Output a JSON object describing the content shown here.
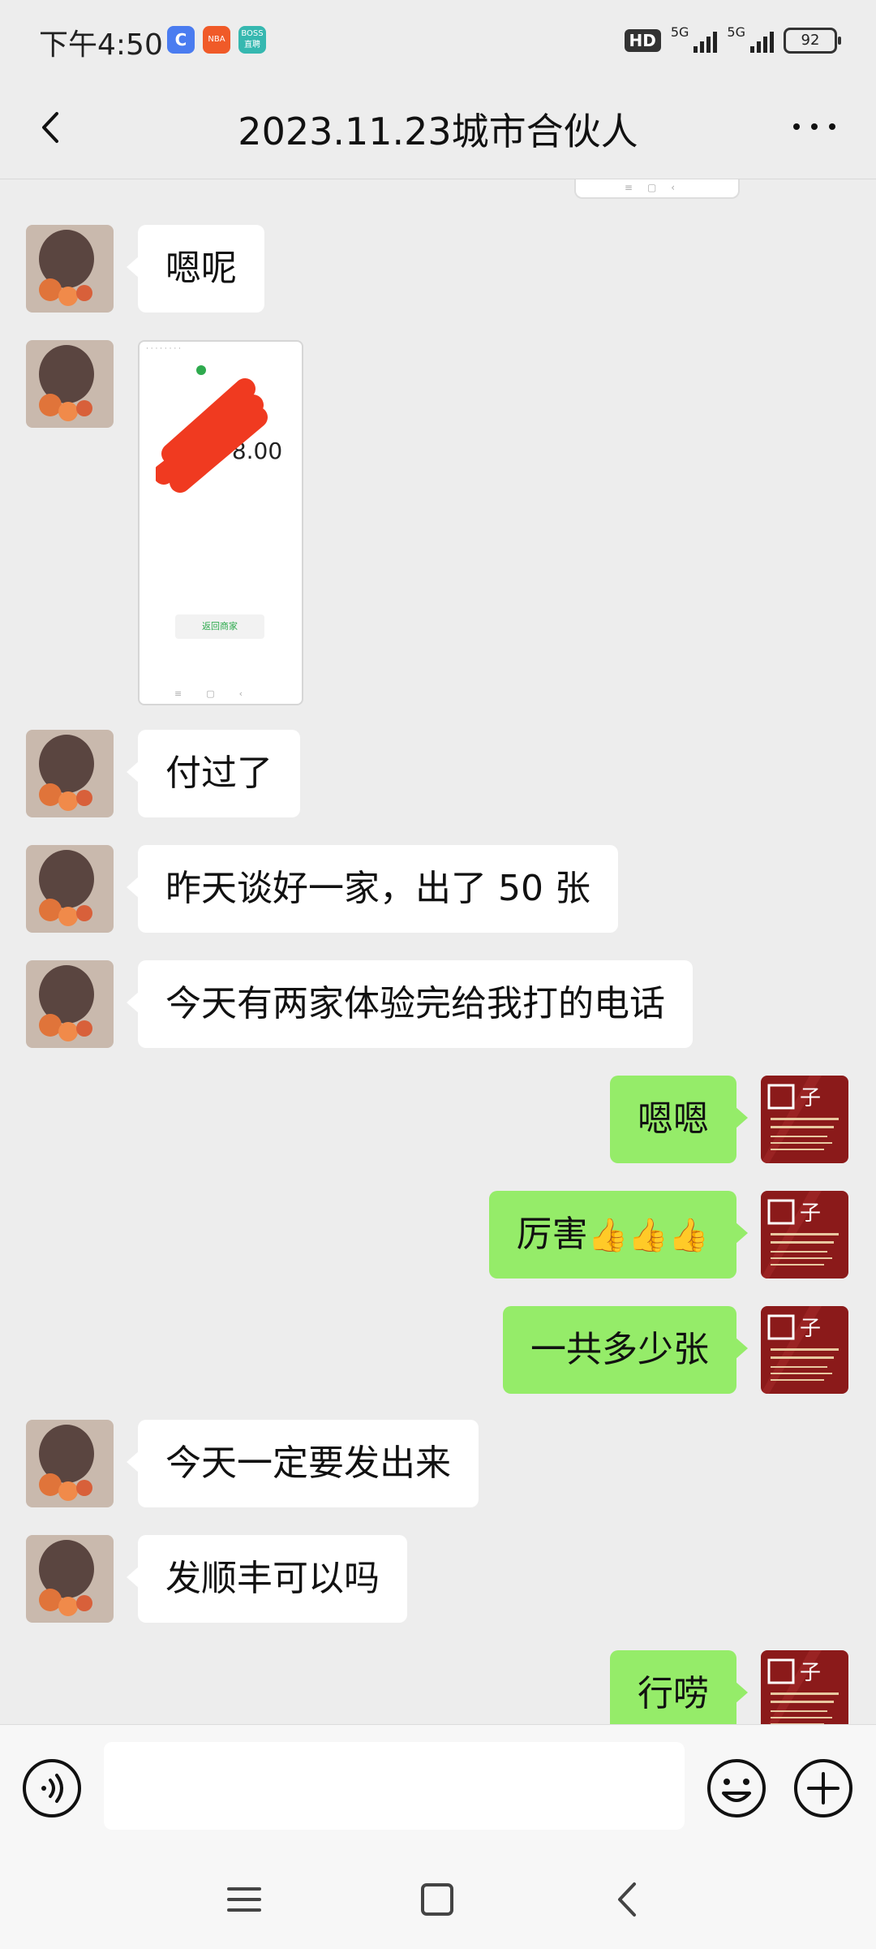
{
  "status_bar": {
    "time": "下午4:50",
    "apps": [
      {
        "name": "c-app-icon",
        "label": "C",
        "color": "#4a7cf0"
      },
      {
        "name": "nba-app-icon",
        "label": "NBA",
        "color": "#f05a28"
      },
      {
        "name": "boss-app-icon",
        "label": "BOSS直聘",
        "color": "#36b8b0"
      }
    ],
    "hd_label": "HD",
    "network_1": "5G",
    "network_2": "5G",
    "battery": "92"
  },
  "header": {
    "title": "2023.11.23城市合伙人",
    "back_icon": "chevron-left-icon",
    "more_icon": "more-dots-icon"
  },
  "messages": [
    {
      "side": "left",
      "type": "text",
      "text": "嗯呢"
    },
    {
      "side": "left",
      "type": "image",
      "image_amount": "78.00",
      "image_button": "返回商家"
    },
    {
      "side": "left",
      "type": "text",
      "text": "付过了"
    },
    {
      "side": "left",
      "type": "text",
      "text": "昨天谈好一家，出了 50 张"
    },
    {
      "side": "left",
      "type": "text",
      "text": "今天有两家体验完给我打的电话"
    },
    {
      "side": "right",
      "type": "text",
      "text": "嗯嗯"
    },
    {
      "side": "right",
      "type": "text",
      "text": "厉害",
      "emoji": "👍👍👍"
    },
    {
      "side": "right",
      "type": "text",
      "text": "一共多少张"
    },
    {
      "side": "left",
      "type": "text",
      "text": "今天一定要发出来"
    },
    {
      "side": "left",
      "type": "text",
      "text": "发顺丰可以吗"
    },
    {
      "side": "right",
      "type": "text",
      "text": "行唠"
    }
  ],
  "input_bar": {
    "voice_icon": "voice-icon",
    "input_value": "",
    "emoji_icon": "emoji-icon",
    "plus_icon": "plus-icon"
  },
  "nav_bar": {
    "icons": [
      "menu-icon",
      "home-icon",
      "back-icon"
    ]
  },
  "colors": {
    "background": "#ededed",
    "my_bubble": "#95ec69",
    "their_bubble": "#ffffff",
    "my_avatar": "#8b1a1a"
  }
}
